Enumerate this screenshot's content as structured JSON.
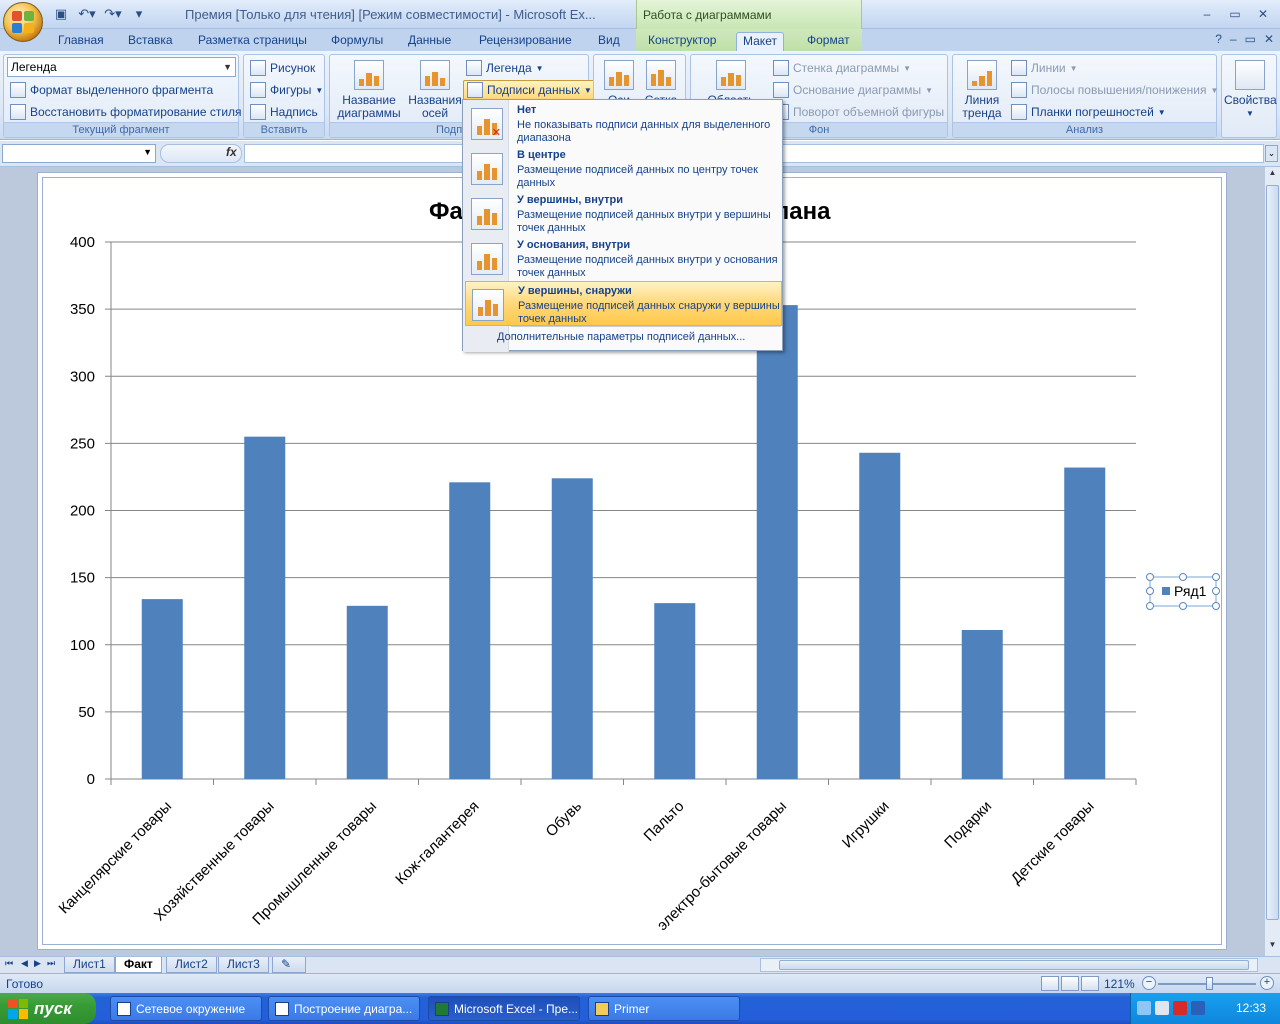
{
  "titlebar": {
    "document_title": "Премия  [Только для чтения]  [Режим совместимости] - Microsoft Ex...",
    "context_title": "Работа с диаграммами"
  },
  "tabs": [
    {
      "label": "Главная"
    },
    {
      "label": "Вставка"
    },
    {
      "label": "Разметка страницы"
    },
    {
      "label": "Формулы"
    },
    {
      "label": "Данные"
    },
    {
      "label": "Рецензирование"
    },
    {
      "label": "Вид"
    },
    {
      "label": "Конструктор"
    },
    {
      "label": "Макет"
    },
    {
      "label": "Формат"
    }
  ],
  "active_tab": "Макет",
  "ribbon": {
    "current_fragment": {
      "selector_value": "Легенда",
      "format_selection": "Формат выделенного фрагмента",
      "reset_style": "Восстановить форматирование стиля",
      "group_label": "Текущий фрагмент"
    },
    "insert": {
      "picture": "Рисунок",
      "shapes": "Фигуры",
      "text_box": "Надпись",
      "group_label": "Вставить"
    },
    "labels": {
      "chart_title": "Название\nдиаграммы",
      "axis_titles": "Названия\nосей",
      "legend": "Легенда",
      "data_labels": "Подписи данных",
      "group_label_partial": "Подп"
    },
    "axes": {
      "axes_partial": "Оси",
      "grid_partial": "Сетка"
    },
    "background": {
      "plot_area_partial": "Область",
      "chart_wall": "Стенка диаграммы",
      "chart_floor": "Основание диаграммы",
      "rotation_3d": "Поворот объемной фигуры",
      "group_label": "Фон"
    },
    "analysis": {
      "trendline": "Линия\nтренда",
      "lines": "Линии",
      "updown_bars": "Полосы повышения/понижения",
      "error_bars": "Планки погрешностей",
      "group_label": "Анализ"
    },
    "properties": {
      "label": "Свойства"
    }
  },
  "formula_bar": {
    "fx": "fx",
    "name_box": "",
    "formula": ""
  },
  "data_labels_menu": {
    "items": [
      {
        "title": "Нет",
        "description": "Не показывать подписи данных для выделенного диапазона",
        "highlighted": false,
        "icon": "no-labels-icon"
      },
      {
        "title": "В центре",
        "description": "Размещение подписей данных по центру точек данных",
        "highlighted": false,
        "icon": "center-labels-icon"
      },
      {
        "title": "У вершины, внутри",
        "description": "Размещение подписей данных внутри у вершины точек данных",
        "highlighted": false,
        "icon": "inside-end-labels-icon"
      },
      {
        "title": "У основания, внутри",
        "description": "Размещение подписей данных внутри у основания точек данных",
        "highlighted": false,
        "icon": "inside-base-labels-icon"
      },
      {
        "title": "У вершины, снаружи",
        "description": "Размещение подписей данных снаружи у вершины точек данных",
        "highlighted": true,
        "icon": "outside-end-labels-icon"
      }
    ],
    "more_options": "Дополнительные параметры подписей данных..."
  },
  "chart_data": {
    "type": "bar",
    "title_visible_left": "Фа",
    "title_visible_right": "лана",
    "categories": [
      "Канцелярские товары",
      "Хозяйственные товары",
      "Промышленные товары",
      "Кож-галантерея",
      "Обувь",
      "Пальто",
      "электро-бытовые товары",
      "Игрушки",
      "Подарки",
      "Детские товары"
    ],
    "series": [
      {
        "name": "Ряд1",
        "values": [
          134,
          255,
          129,
          221,
          224,
          131,
          353,
          243,
          111,
          232
        ],
        "color": "#4f81bd"
      }
    ],
    "ylim": [
      0,
      400
    ],
    "yticks": [
      0,
      50,
      100,
      150,
      200,
      250,
      300,
      350,
      400
    ],
    "grid": true,
    "legend_position": "right",
    "xlabel": "",
    "ylabel": ""
  },
  "sheet_tabs": [
    {
      "label": "Лист1",
      "active": false
    },
    {
      "label": "Факт",
      "active": true
    },
    {
      "label": "Лист2",
      "active": false
    },
    {
      "label": "Лист3",
      "active": false
    }
  ],
  "status": {
    "ready": "Готово",
    "zoom": "121%"
  },
  "taskbar": {
    "start": "пуск",
    "items": [
      {
        "label": "Сетевое окружение",
        "active": false
      },
      {
        "label": "Построение диагра...",
        "active": false
      },
      {
        "label": "Microsoft Excel - Пре...",
        "active": true
      },
      {
        "label": "Primer",
        "active": false
      }
    ],
    "language": "RU",
    "clock": "12:33"
  },
  "colors": {
    "bar": "#4f81bd",
    "highlight": "#ffd87a",
    "taskbar": "#245edb",
    "start": "#379c35"
  }
}
